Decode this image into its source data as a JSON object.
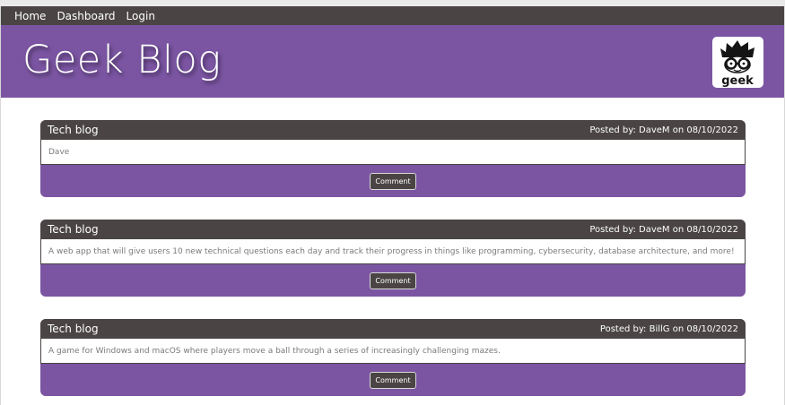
{
  "nav": {
    "links": [
      "Home",
      "Dashboard",
      "Login"
    ]
  },
  "header": {
    "title": "Geek Blog",
    "logo_text": "geek"
  },
  "posts": [
    {
      "title": "Tech blog",
      "meta": "Posted by: DaveM on 08/10/2022",
      "content": "Dave",
      "button": "Comment"
    },
    {
      "title": "Tech blog",
      "meta": "Posted by: DaveM on 08/10/2022",
      "content": "A web app that will give users 10 new technical questions each day and track their progress in things like programming, cybersecurity, database architecture, and more!",
      "button": "Comment"
    },
    {
      "title": "Tech blog",
      "meta": "Posted by: BillG on 08/10/2022",
      "content": "A game for Windows and macOS where players move a ball through a series of increasingly challenging mazes.",
      "button": "Comment"
    }
  ],
  "colors": {
    "nav_bg": "#4a4444",
    "accent": "#7b55a2",
    "text_muted": "#7a7a7a"
  }
}
